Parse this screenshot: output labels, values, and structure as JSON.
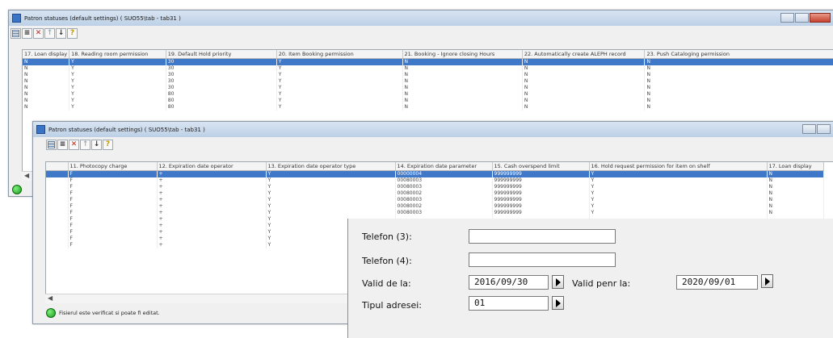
{
  "win1": {
    "title": "Patron statuses (default settings) ( SUO55\\tab - tab31 )",
    "columns": [
      "17. Loan display",
      "18. Reading room permission",
      "19. Default Hold priority",
      "20. Item Booking permission",
      "21. Booking - Ignore closing Hours",
      "22. Automatically create ALEPH record",
      "23. Push Cataloging permission"
    ],
    "rows": [
      [
        "N",
        "Y",
        "30",
        "Y",
        "N",
        "N",
        "N"
      ],
      [
        "N",
        "Y",
        "30",
        "Y",
        "N",
        "N",
        "N"
      ],
      [
        "N",
        "Y",
        "30",
        "Y",
        "N",
        "N",
        "N"
      ],
      [
        "N",
        "Y",
        "30",
        "Y",
        "N",
        "N",
        "N"
      ],
      [
        "N",
        "Y",
        "30",
        "Y",
        "N",
        "N",
        "N"
      ],
      [
        "N",
        "Y",
        "80",
        "Y",
        "N",
        "N",
        "N"
      ],
      [
        "N",
        "Y",
        "80",
        "Y",
        "N",
        "N",
        "N"
      ],
      [
        "N",
        "Y",
        "80",
        "Y",
        "N",
        "N",
        "N"
      ]
    ]
  },
  "win2": {
    "title": "Patron statuses (default settings) ( SUO55\\tab - tab31 )",
    "columns": [
      "11. Photocopy charge",
      "12. Expiration date operator",
      "13. Expiration date operator type",
      "14. Expiration date parameter",
      "15. Cash overspend limit",
      "16. Hold request permission for item on shelf",
      "17. Loan display"
    ],
    "rows": [
      [
        "F",
        "+",
        "Y",
        "00000004",
        "999999999",
        "Y",
        "N"
      ],
      [
        "F",
        "+",
        "Y",
        "00080003",
        "999999999",
        "Y",
        "N"
      ],
      [
        "F",
        "+",
        "Y",
        "00080003",
        "999999999",
        "Y",
        "N"
      ],
      [
        "F",
        "+",
        "Y",
        "00080002",
        "999999999",
        "Y",
        "N"
      ],
      [
        "F",
        "+",
        "Y",
        "00080003",
        "999999999",
        "Y",
        "N"
      ],
      [
        "F",
        "+",
        "Y",
        "00080002",
        "999999999",
        "Y",
        "N"
      ],
      [
        "F",
        "+",
        "Y",
        "00080003",
        "999999999",
        "Y",
        "N"
      ],
      [
        "F",
        "+",
        "Y",
        "",
        "",
        "",
        ""
      ],
      [
        "F",
        "+",
        "Y",
        "",
        "",
        "",
        ""
      ],
      [
        "F",
        "+",
        "Y",
        "",
        "",
        "",
        ""
      ],
      [
        "F",
        "+",
        "Y",
        "",
        "",
        "",
        ""
      ],
      [
        "F",
        "+",
        "Y",
        "",
        "",
        "",
        ""
      ]
    ],
    "status": "Fisierul este verificat si poate fi editat."
  },
  "form": {
    "telefon3_label": "Telefon (3):",
    "telefon3_value": "",
    "telefon4_label": "Telefon (4):",
    "telefon4_value": "",
    "valid_from_label": "Valid de la:",
    "valid_from_value": "2016/09/30",
    "valid_to_label": "Valid penr la:",
    "valid_to_value": "2020/09/01",
    "address_type_label": "Tipul adresei:",
    "address_type_value": "01"
  },
  "colors": {
    "selection": "#3f78c9",
    "titlebar": "#c8d8ea",
    "status_ok": "#1a9a1a"
  }
}
